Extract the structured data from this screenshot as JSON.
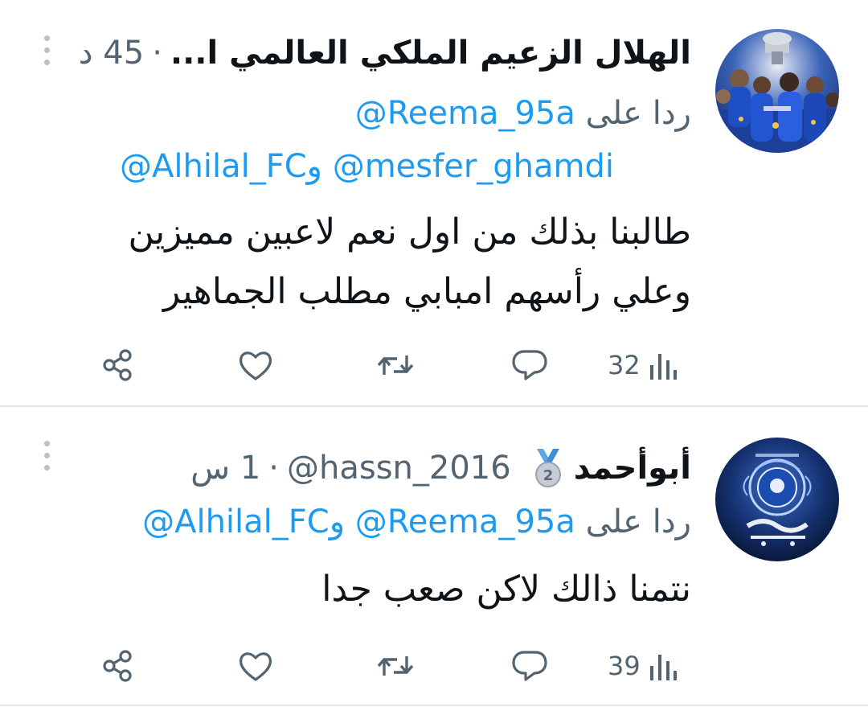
{
  "tweets": [
    {
      "display_name": "الهلال الزعيم الملكي العالمي ا...",
      "time": "45 د",
      "separator": "·",
      "reply_prefix": "ردا على",
      "reply_mention_1": "@Reema_95a",
      "reply_mention_2": "@mesfer_ghamdi",
      "reply_joiner": "و",
      "reply_mention_3": "@Alhilal_FC",
      "body_line_1": "طالبنا بذلك من اول نعم لاعبين مميزين",
      "body_line_2": "وعلي رأسهم امبابي مطلب الجماهير",
      "views": "32",
      "avatar_icon": "team-photo-avatar"
    },
    {
      "display_name": "أبوأحمد",
      "badge_icon": "medal-2-icon",
      "handle": "@hassn_2016",
      "separator": "·",
      "time": "1 س",
      "reply_prefix": "ردا على",
      "reply_mention_1": "@Reema_95a",
      "reply_joiner": "و",
      "reply_mention_2": "@Alhilal_FC",
      "body_line_1": "نتمنا ذالك لاكن صعب جدا",
      "views": "39",
      "avatar_icon": "alhilal-logo-avatar"
    }
  ],
  "colors": {
    "accent": "#1d9bf0",
    "secondary_text": "#536471",
    "primary_text": "#0f1419",
    "divider": "#e1e6ea"
  }
}
